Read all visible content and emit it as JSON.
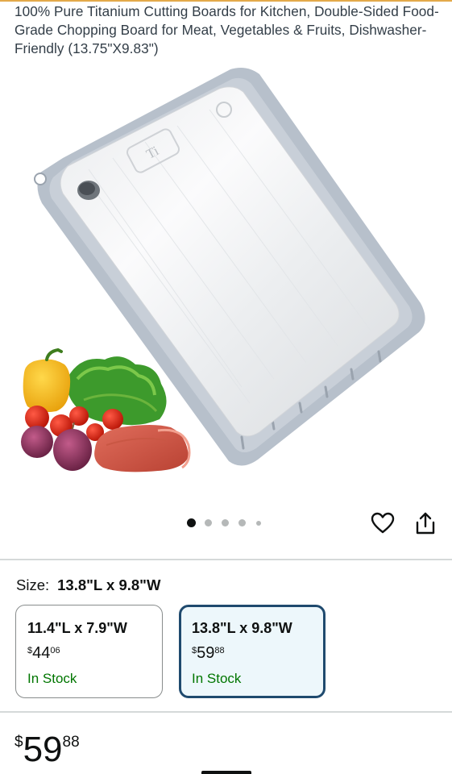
{
  "product": {
    "title": "100% Pure Titanium Cutting Boards for Kitchen, Double-Sided Food-Grade Chopping Board for Meat, Vegetables & Fruits, Dishwasher-Friendly (13.75\"X9.83\")",
    "image_badge": "Ti",
    "image_count": 5,
    "current_image_index": 1
  },
  "actions": {
    "wishlist_icon": "heart-icon",
    "share_icon": "share-icon"
  },
  "size": {
    "label": "Size:",
    "selected_value": "13.8\"L x 9.8\"W",
    "options": [
      {
        "dimension": "11.4\"L x 7.9\"W",
        "price_symbol": "$",
        "price_whole": "44",
        "price_fraction": "06",
        "stock": "In Stock",
        "selected": false
      },
      {
        "dimension": "13.8\"L x 9.8\"W",
        "price_symbol": "$",
        "price_whole": "59",
        "price_fraction": "88",
        "stock": "In Stock",
        "selected": true
      }
    ]
  },
  "price": {
    "symbol": "$",
    "whole": "59",
    "fraction": "88"
  },
  "colors": {
    "link_blue": "#1f4a6e",
    "in_stock_green": "#007600",
    "selected_card_bg": "#edf7fb"
  }
}
